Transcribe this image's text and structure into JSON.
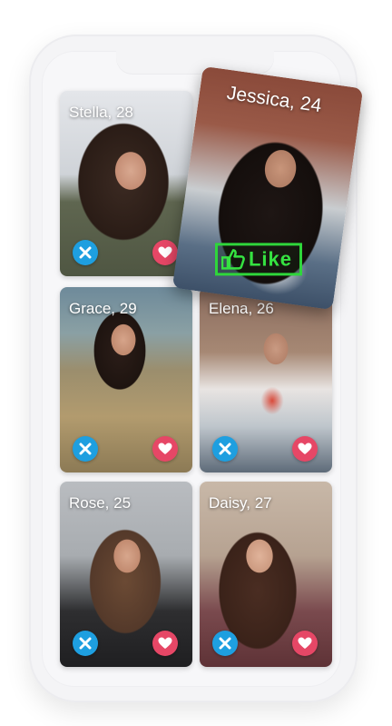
{
  "cards": [
    {
      "id": "stella",
      "name": "Stella, 28"
    },
    {
      "id": "grace",
      "name": "Grace, 29"
    },
    {
      "id": "elena",
      "name": "Elena, 26"
    },
    {
      "id": "rose",
      "name": "Rose, 25"
    },
    {
      "id": "daisy",
      "name": "Daisy, 27"
    }
  ],
  "top_card": {
    "name": "Jessica, 24",
    "stamp": "Like"
  },
  "icons": {
    "reject": "close-x-icon",
    "like": "heart-icon",
    "stamp": "thumbs-up-icon"
  },
  "colors": {
    "reject": "#1e9fe0",
    "like": "#e64766",
    "stamp": "#35e341"
  }
}
